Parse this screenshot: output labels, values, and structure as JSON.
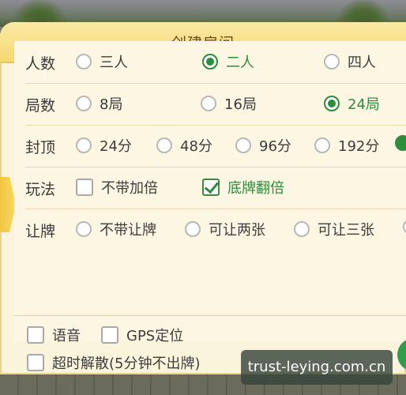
{
  "dialog": {
    "title": "创建房间"
  },
  "rows": {
    "players": {
      "label": "人数",
      "options": [
        "三人",
        "二人",
        "四人"
      ],
      "selected": "二人"
    },
    "rounds": {
      "label": "局数",
      "options": [
        "8局",
        "16局",
        "24局"
      ],
      "selected": "24局"
    },
    "cap": {
      "label": "封顶",
      "options": [
        "24分",
        "48分",
        "96分",
        "192分"
      ],
      "selected": ""
    },
    "play": {
      "label": "玩法",
      "options": [
        "不带加倍",
        "底牌翻倍"
      ],
      "checked": [
        "底牌翻倍"
      ]
    },
    "concede": {
      "label": "让牌",
      "options": [
        "不带让牌",
        "可让两张",
        "可让三张"
      ],
      "selected": ""
    }
  },
  "bottom": {
    "voice_label": "语音",
    "gps_label": "GPS定位",
    "timeout_label": "超时解散(5分钟不出牌)"
  },
  "watermark": "trust-leying.com.cn",
  "colors": {
    "accent_green": "#2c8d3a",
    "title_bar": "#f5d971",
    "panel": "#fcf6e2"
  }
}
